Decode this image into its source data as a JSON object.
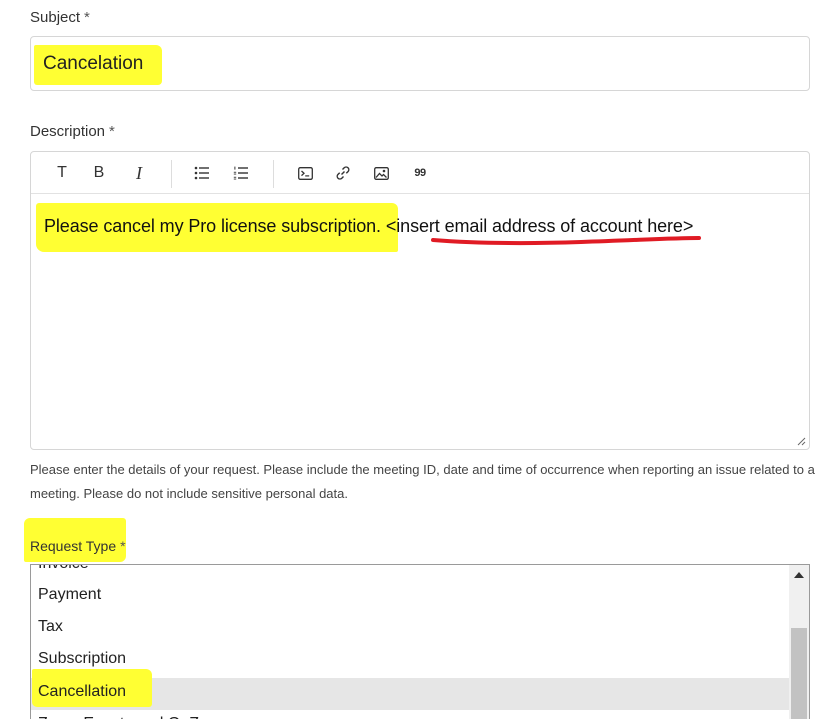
{
  "subject": {
    "label": "Subject",
    "required_mark": "*",
    "value": "Cancelation"
  },
  "description": {
    "label": "Description",
    "required_mark": "*",
    "toolbar": {
      "text_style": "T",
      "bold": "B",
      "italic": "I",
      "quote": "99"
    },
    "body_highlighted": "Please cancel my Pro license subscription.",
    "body_placeholder": "<insert email address of account here>",
    "help": "Please enter the details of your request. Please include the meeting ID, date and time of occurrence when reporting an issue related to a meeting. Please do not include sensitive personal data."
  },
  "request_type": {
    "label": "Request Type",
    "required_mark": "*",
    "options": [
      "Invoice",
      "Payment",
      "Tax",
      "Subscription",
      "Cancellation",
      "Zoom Events and OnZoom"
    ],
    "selected": "Cancellation"
  },
  "colors": {
    "highlight": "#ffff33",
    "annotation": "#e01b24"
  }
}
